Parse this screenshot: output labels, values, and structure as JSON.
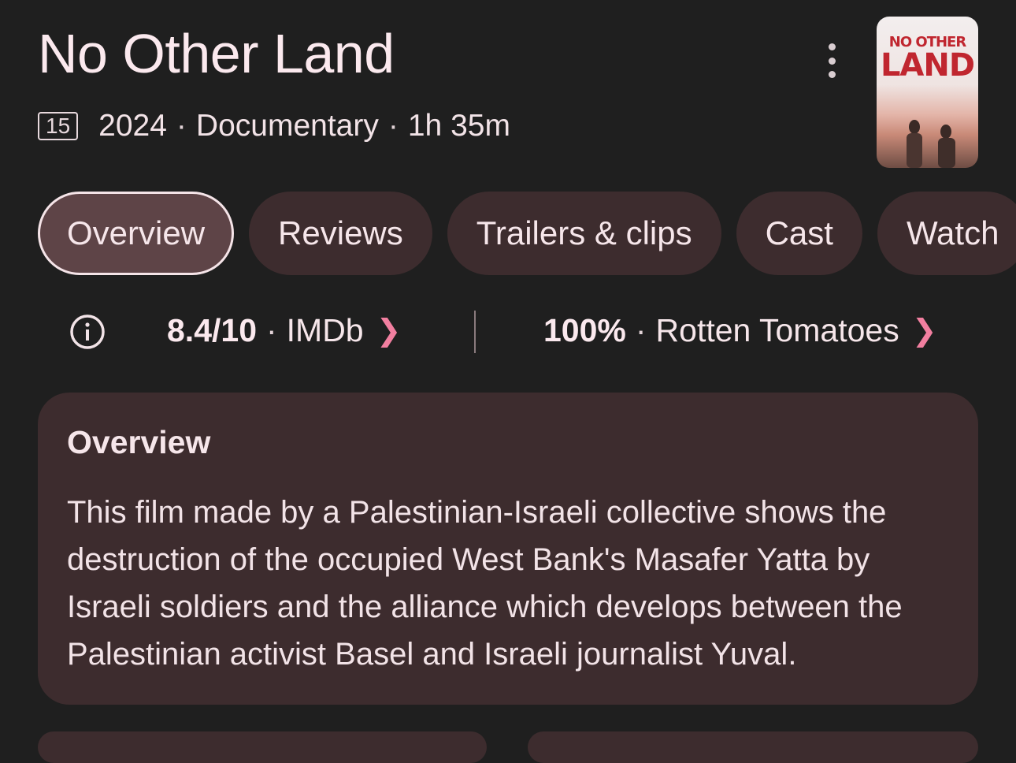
{
  "movie": {
    "title": "No Other Land",
    "age_rating": "15",
    "year": "2024",
    "genre": "Documentary",
    "duration": "1h 35m",
    "separator": "·"
  },
  "poster": {
    "line1": "NO OTHER",
    "line2": "LAND"
  },
  "tabs": [
    {
      "label": "Overview",
      "active": true
    },
    {
      "label": "Reviews"
    },
    {
      "label": "Trailers & clips"
    },
    {
      "label": "Cast"
    },
    {
      "label": "Watch"
    }
  ],
  "ratings": {
    "imdb": {
      "score": "8.4/10",
      "source": "IMDb"
    },
    "rotten_tomatoes": {
      "score": "100%",
      "source": "Rotten Tomatoes"
    }
  },
  "overview": {
    "heading": "Overview",
    "text": "This film made by a Palestinian-Israeli collective shows the destruction of the occupied West Bank's Masafer Yatta by Israeli soldiers and the alliance which develops between the Palestinian activist Basel and Israeli journalist Yuval."
  },
  "icons": {
    "info": "info-icon",
    "more": "more-vert-icon",
    "chevron": "chevron-right-icon"
  },
  "colors": {
    "background": "#1f1f1f",
    "chip": "#3d2c2e",
    "chip_active": "#5e4447",
    "accent": "#f27fa0",
    "text": "#f6e6ea"
  }
}
